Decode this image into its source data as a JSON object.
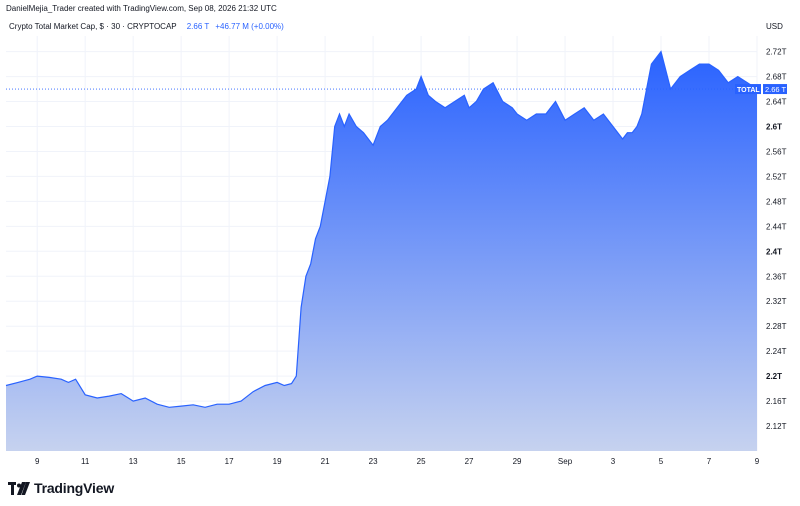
{
  "header": {
    "attribution": "DanielMejia_Trader created with TradingView.com, Sep 08, 2026 21:32 UTC"
  },
  "legend": {
    "symbol": "Crypto Total Market Cap, $ · 30 · CRYPTOCAP",
    "last_price": "2.66 T",
    "change": "+46.77 M (+0.00%)"
  },
  "axis": {
    "currency": "USD"
  },
  "brand": {
    "name": "TradingView"
  },
  "colors": {
    "line": "#2962ff",
    "fill_top": "#2962ff",
    "fill_bottom": "#c6d2ef",
    "grid": "#f0f3fa",
    "price_label_bg": "#2962ff"
  },
  "chart_data": {
    "type": "area",
    "symbol": "TOTAL",
    "last_value": 2.66,
    "last_value_label": "2.66 T",
    "ylim": [
      2.08,
      2.745
    ],
    "yticks": [
      "2.72T",
      "2.68T",
      "2.64T",
      "2.6T",
      "2.56T",
      "2.52T",
      "2.48T",
      "2.44T",
      "2.4T",
      "2.36T",
      "2.32T",
      "2.28T",
      "2.24T",
      "2.2T",
      "2.16T",
      "2.12T"
    ],
    "ytick_values": [
      2.72,
      2.68,
      2.64,
      2.6,
      2.56,
      2.52,
      2.48,
      2.44,
      2.4,
      2.36,
      2.32,
      2.28,
      2.24,
      2.2,
      2.16,
      2.12
    ],
    "ytick_bold": [
      "2.6T",
      "2.4T",
      "2.2T"
    ],
    "xticks": [
      "9",
      "11",
      "13",
      "15",
      "17",
      "19",
      "21",
      "23",
      "25",
      "27",
      "29",
      "Sep",
      "3",
      "5",
      "7",
      "9"
    ],
    "xtick_days": [
      9,
      11,
      13,
      15,
      17,
      19,
      21,
      23,
      25,
      27,
      29,
      31,
      33,
      35,
      37,
      39
    ],
    "xlim_days": [
      7.7,
      39
    ],
    "grid": true,
    "series": [
      {
        "day": [
          7.7,
          8.2,
          8.7,
          9.0,
          9.5,
          10.0,
          10.3,
          10.6,
          11.0,
          11.5,
          12.0,
          12.5,
          13.0,
          13.5,
          14.0,
          14.5,
          15.0,
          15.5,
          16.0,
          16.5,
          17.0,
          17.5,
          18.0,
          18.5,
          19.0,
          19.3,
          19.6,
          19.8,
          20.0,
          20.2,
          20.4,
          20.6,
          20.8,
          21.0,
          21.2,
          21.4,
          21.6,
          21.8,
          22.0,
          22.3,
          22.6,
          23.0,
          23.3,
          23.6,
          24.0,
          24.4,
          24.8,
          25.0,
          25.3,
          25.6,
          26.0,
          26.4,
          26.8,
          27.0,
          27.3,
          27.6,
          28.0,
          28.4,
          28.8,
          29.0,
          29.4,
          29.8,
          30.2,
          30.6,
          31.0,
          31.4,
          31.8,
          32.2,
          32.6,
          33.0,
          33.4,
          33.6,
          33.8,
          34.0,
          34.2,
          34.4,
          34.6,
          35.0,
          35.4,
          35.8,
          36.2,
          36.6,
          37.0,
          37.4,
          37.8,
          38.2,
          38.6,
          39.0
        ],
        "value": [
          2.185,
          2.19,
          2.195,
          2.2,
          2.198,
          2.195,
          2.19,
          2.195,
          2.17,
          2.165,
          2.168,
          2.172,
          2.16,
          2.165,
          2.155,
          2.15,
          2.152,
          2.154,
          2.15,
          2.155,
          2.155,
          2.16,
          2.175,
          2.185,
          2.19,
          2.185,
          2.188,
          2.2,
          2.31,
          2.36,
          2.38,
          2.42,
          2.44,
          2.48,
          2.52,
          2.6,
          2.62,
          2.6,
          2.62,
          2.6,
          2.59,
          2.57,
          2.6,
          2.61,
          2.63,
          2.65,
          2.66,
          2.68,
          2.65,
          2.64,
          2.63,
          2.64,
          2.65,
          2.63,
          2.64,
          2.66,
          2.67,
          2.64,
          2.63,
          2.62,
          2.61,
          2.62,
          2.62,
          2.64,
          2.61,
          2.62,
          2.63,
          2.61,
          2.62,
          2.6,
          2.58,
          2.59,
          2.59,
          2.6,
          2.62,
          2.66,
          2.7,
          2.72,
          2.66,
          2.68,
          2.69,
          2.7,
          2.7,
          2.69,
          2.67,
          2.68,
          2.67,
          2.66
        ]
      }
    ]
  }
}
